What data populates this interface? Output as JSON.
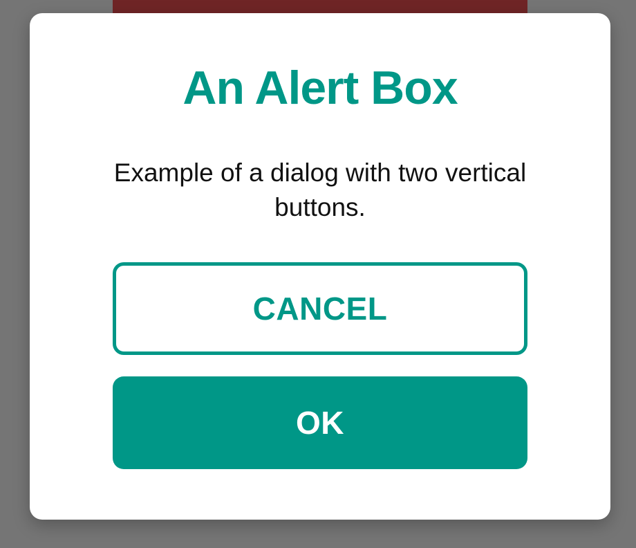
{
  "dialog": {
    "title": "An Alert Box",
    "message": "Example of a dialog with two vertical buttons.",
    "cancel_label": "CANCEL",
    "ok_label": "OK"
  },
  "colors": {
    "accent": "#009787",
    "scrim": "#757575",
    "background_strip": "#6f2526",
    "ok_text": "#ffffff"
  }
}
